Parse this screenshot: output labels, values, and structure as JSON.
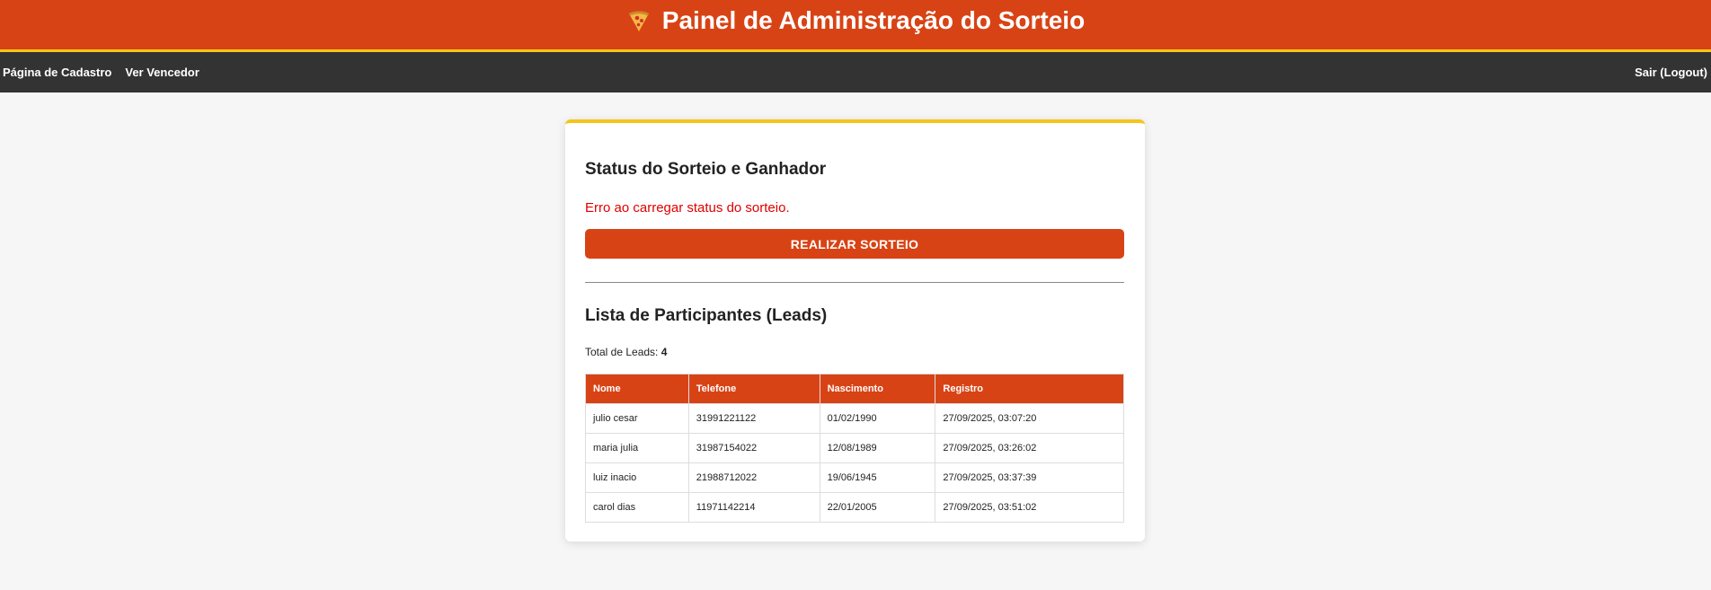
{
  "header": {
    "title": "Painel de Administração do Sorteio",
    "icon": "pizza-icon"
  },
  "nav": {
    "links": [
      "Página de Cadastro",
      "Ver Vencedor"
    ],
    "logout_label": "Sair (Logout)"
  },
  "status": {
    "title": "Status do Sorteio e Ganhador",
    "error_message": "Erro ao carregar status do sorteio.",
    "draw_button_label": "REALIZAR SORTEIO"
  },
  "leads": {
    "title": "Lista de Participantes (Leads)",
    "total_label": "Total de Leads:",
    "total_value": "4",
    "columns": [
      "Nome",
      "Telefone",
      "Nascimento",
      "Registro"
    ],
    "rows": [
      [
        "julio cesar",
        "31991221122",
        "01/02/1990",
        "27/09/2025, 03:07:20"
      ],
      [
        "maria julia",
        "31987154022",
        "12/08/1989",
        "27/09/2025, 03:26:02"
      ],
      [
        "luiz inacio",
        "21988712022",
        "19/06/1945",
        "27/09/2025, 03:37:39"
      ],
      [
        "carol dias",
        "11971142214",
        "22/01/2005",
        "27/09/2025, 03:51:02"
      ]
    ]
  },
  "colors": {
    "primary": "#d84315",
    "accent": "#f5c518",
    "nav_bg": "#333333",
    "error": "#e00000"
  }
}
